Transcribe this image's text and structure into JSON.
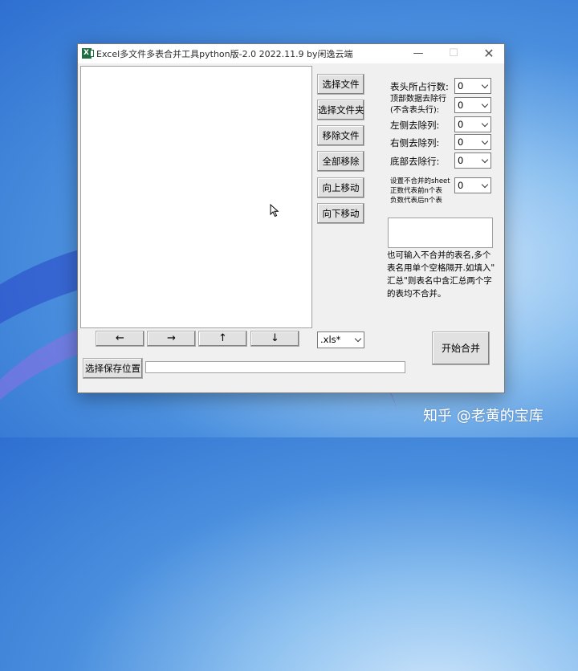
{
  "window": {
    "title": "Excel多文件多表合并工具python版-2.0 2022.11.9 by闲逸云端",
    "controls": {
      "minimize": "—",
      "maximize": "☐",
      "close": "✕"
    }
  },
  "file_list": {
    "items": []
  },
  "side_buttons": {
    "select_file": "选择文件",
    "select_folder": "选择文件夹",
    "remove_file": "移除文件",
    "remove_all": "全部移除",
    "move_up": "向上移动",
    "move_down": "向下移动"
  },
  "arrow_buttons": {
    "left": "←",
    "right": "→",
    "up": "↑",
    "down": "↓"
  },
  "file_type": {
    "selected": ".xls*"
  },
  "settings": {
    "header_rows": {
      "label": "表头所占行数:",
      "value": "0"
    },
    "top_rows": {
      "label_line1": "顶部数据去除行",
      "label_line2": "(不含表头行):",
      "value": "0"
    },
    "left_cols": {
      "label": "左侧去除列:",
      "value": "0"
    },
    "right_cols": {
      "label": "右侧去除列:",
      "value": "0"
    },
    "bottom_rows": {
      "label": "底部去除行:",
      "value": "0"
    },
    "skip_sheets": {
      "label_line1": "设置不合并的sheet",
      "label_line2": "正数代表前n个表",
      "label_line3": "负数代表后n个表",
      "value": "0"
    }
  },
  "exclude_names": {
    "value": "",
    "hint_line1": "也可输入不合并的表名,多个",
    "hint_line2": "表名用单个空格隔开.如填入\"",
    "hint_line3": "汇总\"则表名中含汇总两个字",
    "hint_line4": "的表均不合并。"
  },
  "start_button": "开始合并",
  "save_location": {
    "button": "选择保存位置",
    "path": ""
  },
  "watermark": "知乎 @老黄的宝库"
}
